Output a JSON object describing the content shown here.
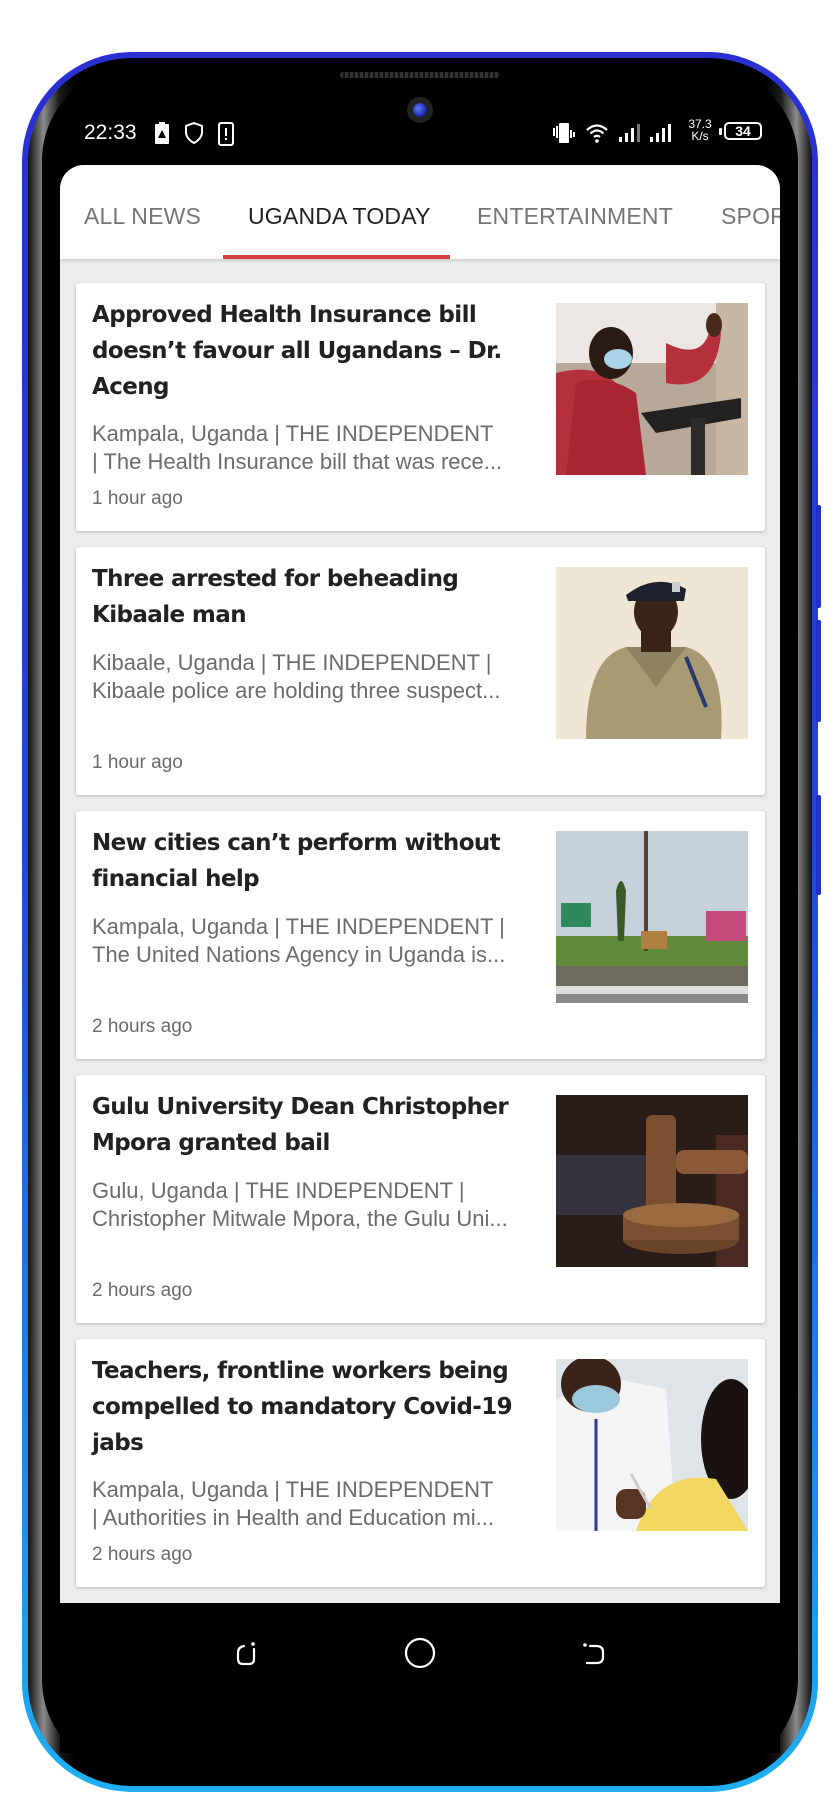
{
  "status_bar": {
    "time": "22:33",
    "left_icons": [
      "battery-alert-icon",
      "shield-icon",
      "phone-alert-icon"
    ],
    "right_icons": [
      "vibrate-icon",
      "wifi-icon",
      "signal-icon",
      "signal-icon"
    ],
    "net_speed_value": "37.3",
    "net_speed_unit": "K/s",
    "battery_level": "34"
  },
  "tabs": [
    {
      "label": "ALL NEWS",
      "active": false
    },
    {
      "label": "UGANDA TODAY",
      "active": true
    },
    {
      "label": "ENTERTAINMENT",
      "active": false
    },
    {
      "label": "SPORTS",
      "active": false
    }
  ],
  "tabs_visible_partial": "SPOR",
  "accent_color": "#d23f3f",
  "articles": [
    {
      "title": "Approved Health Insurance bill doesn’t favour all Ugandans – Dr. Aceng",
      "summary_line1": "Kampala, Uganda | THE INDEPENDENT",
      "summary_line2": "| The Health Insurance bill that was rece...",
      "time": "1 hour ago",
      "image": "woman-in-red-jacket-at-podium"
    },
    {
      "title": "Three arrested for beheading Kibaale man",
      "summary_line1": "Kibaale, Uganda | THE INDEPENDENT |",
      "summary_line2": "Kibaale police are holding three suspect...",
      "time": "1 hour ago",
      "image": "police-officer-portrait"
    },
    {
      "title": "New cities can’t perform without financial help",
      "summary_line1": "Kampala, Uganda | THE INDEPENDENT |",
      "summary_line2": "The United Nations Agency in Uganda is...",
      "time": "2 hours ago",
      "image": "city-roundabout-with-lion-statue"
    },
    {
      "title": "Gulu University Dean Christopher Mpora granted bail",
      "summary_line1": "Gulu, Uganda | THE INDEPENDENT |",
      "summary_line2": "Christopher Mitwale Mpora, the Gulu Uni...",
      "time": "2 hours ago",
      "image": "judge-gavel"
    },
    {
      "title": "Teachers, frontline workers being compelled to mandatory Covid-19 jabs",
      "summary_line1": "Kampala, Uganda | THE INDEPENDENT",
      "summary_line2": "| Authorities in Health and Education mi...",
      "time": "2 hours ago",
      "image": "covid-vaccination"
    }
  ],
  "nav_bar": [
    "recents-icon",
    "home-icon",
    "back-icon"
  ]
}
